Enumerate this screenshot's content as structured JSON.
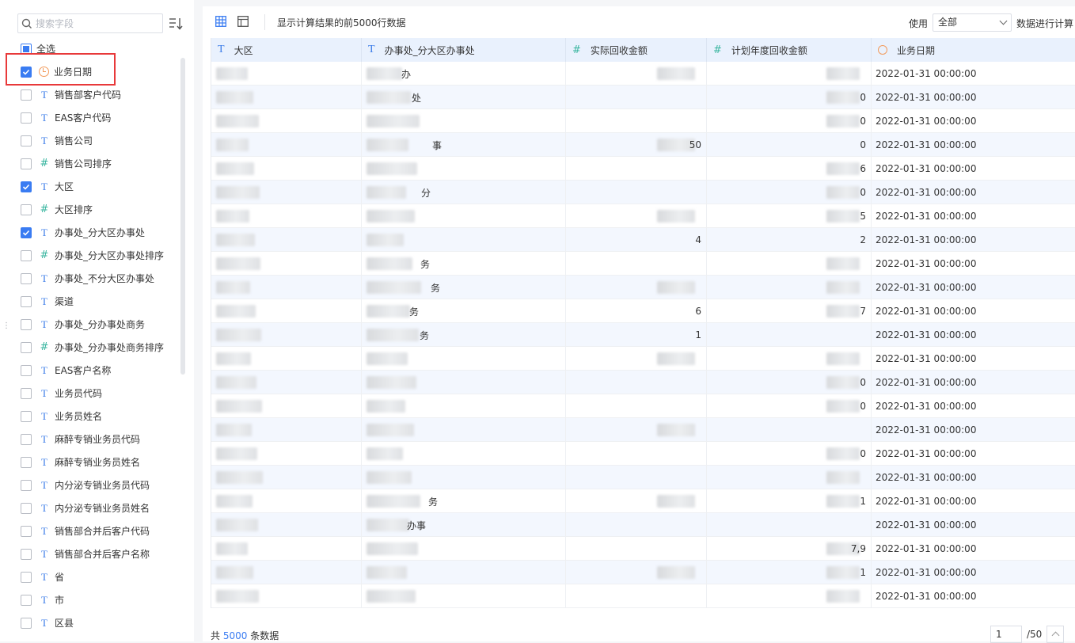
{
  "sidebar": {
    "search_placeholder": "搜索字段",
    "select_all": "全选",
    "fields": [
      {
        "label": "业务日期",
        "type": "date",
        "checked": true
      },
      {
        "label": "销售部客户代码",
        "type": "text",
        "checked": false
      },
      {
        "label": "EAS客户代码",
        "type": "text",
        "checked": false
      },
      {
        "label": "销售公司",
        "type": "text",
        "checked": false
      },
      {
        "label": "销售公司排序",
        "type": "number",
        "checked": false
      },
      {
        "label": "大区",
        "type": "text",
        "checked": true
      },
      {
        "label": "大区排序",
        "type": "number",
        "checked": false
      },
      {
        "label": "办事处_分大区办事处",
        "type": "text",
        "checked": true
      },
      {
        "label": "办事处_分大区办事处排序",
        "type": "number",
        "checked": false
      },
      {
        "label": "办事处_不分大区办事处",
        "type": "text",
        "checked": false
      },
      {
        "label": "渠道",
        "type": "text",
        "checked": false
      },
      {
        "label": "办事处_分办事处商务",
        "type": "text",
        "checked": false
      },
      {
        "label": "办事处_分办事处商务排序",
        "type": "number",
        "checked": false
      },
      {
        "label": "EAS客户名称",
        "type": "text",
        "checked": false
      },
      {
        "label": "业务员代码",
        "type": "text",
        "checked": false
      },
      {
        "label": "业务员姓名",
        "type": "text",
        "checked": false
      },
      {
        "label": "麻醉专销业务员代码",
        "type": "text",
        "checked": false
      },
      {
        "label": "麻醉专销业务员姓名",
        "type": "text",
        "checked": false
      },
      {
        "label": "内分泌专销业务员代码",
        "type": "text",
        "checked": false
      },
      {
        "label": "内分泌专销业务员姓名",
        "type": "text",
        "checked": false
      },
      {
        "label": "销售部合并后客户代码",
        "type": "text",
        "checked": false
      },
      {
        "label": "销售部合并后客户名称",
        "type": "text",
        "checked": false
      },
      {
        "label": "省",
        "type": "text",
        "checked": false
      },
      {
        "label": "市",
        "type": "text",
        "checked": false
      },
      {
        "label": "区县",
        "type": "text",
        "checked": false
      }
    ]
  },
  "toolbar": {
    "info": "显示计算结果的前5000行数据",
    "use_label": "使用",
    "use_value": "全部",
    "calc_label": "数据进行计算"
  },
  "table": {
    "columns": [
      {
        "label": "大区",
        "type": "text"
      },
      {
        "label": "办事处_分大区办事处",
        "type": "text"
      },
      {
        "label": "实际回收金额",
        "type": "number"
      },
      {
        "label": "计划年度回收金额",
        "type": "number"
      },
      {
        "label": "业务日期",
        "type": "date"
      }
    ],
    "rows": [
      {
        "c2": "办",
        "c3": "",
        "c4": "",
        "date": "2022-01-31 00:00:00"
      },
      {
        "c2": "处",
        "c3": "",
        "c4": "0",
        "date": "2022-01-31 00:00:00"
      },
      {
        "c2": "",
        "c3": "",
        "c4": "0",
        "date": "2022-01-31 00:00:00"
      },
      {
        "c2": "事",
        "c3": "50",
        "c4": "0",
        "date": "2022-01-31 00:00:00"
      },
      {
        "c2": "",
        "c3": "",
        "c4": "6",
        "date": "2022-01-31 00:00:00"
      },
      {
        "c2": "分",
        "c3": "",
        "c4": "0",
        "date": "2022-01-31 00:00:00"
      },
      {
        "c2": "",
        "c3": "",
        "c4": "5",
        "date": "2022-01-31 00:00:00"
      },
      {
        "c2": "",
        "c3": "4",
        "c4": "2",
        "date": "2022-01-31 00:00:00"
      },
      {
        "c2": "务",
        "c3": "",
        "c4": "",
        "date": "2022-01-31 00:00:00"
      },
      {
        "c2": "务",
        "c3": "",
        "c4": "",
        "date": "2022-01-31 00:00:00"
      },
      {
        "c2": "务",
        "c3": "6",
        "c4": "7",
        "date": "2022-01-31 00:00:00"
      },
      {
        "c2": "务",
        "c3": "1",
        "c4": "",
        "date": "2022-01-31 00:00:00"
      },
      {
        "c2": "",
        "c3": "",
        "c4": "",
        "date": "2022-01-31 00:00:00"
      },
      {
        "c2": "",
        "c3": "",
        "c4": "0",
        "date": "2022-01-31 00:00:00"
      },
      {
        "c2": "",
        "c3": "",
        "c4": "0",
        "date": "2022-01-31 00:00:00"
      },
      {
        "c2": "",
        "c3": "",
        "c4": "",
        "date": "2022-01-31 00:00:00"
      },
      {
        "c2": "",
        "c3": "",
        "c4": "0",
        "date": "2022-01-31 00:00:00"
      },
      {
        "c2": "",
        "c3": "",
        "c4": "",
        "date": "2022-01-31 00:00:00"
      },
      {
        "c2": "务",
        "c3": "",
        "c4": "1",
        "date": "2022-01-31 00:00:00"
      },
      {
        "c2": "办事",
        "c3": "",
        "c4": "",
        "date": "2022-01-31 00:00:00"
      },
      {
        "c2": "",
        "c3": "",
        "c4": "7,9",
        "date": "2022-01-31 00:00:00"
      },
      {
        "c2": "",
        "c3": "",
        "c4": "1",
        "date": "2022-01-31 00:00:00"
      },
      {
        "c2": "",
        "c3": "",
        "c4": "",
        "date": "2022-01-31 00:00:00"
      }
    ]
  },
  "footer": {
    "prefix": "共",
    "count": "5000",
    "suffix": "条数据",
    "page": "1",
    "total_pages": "/50"
  }
}
